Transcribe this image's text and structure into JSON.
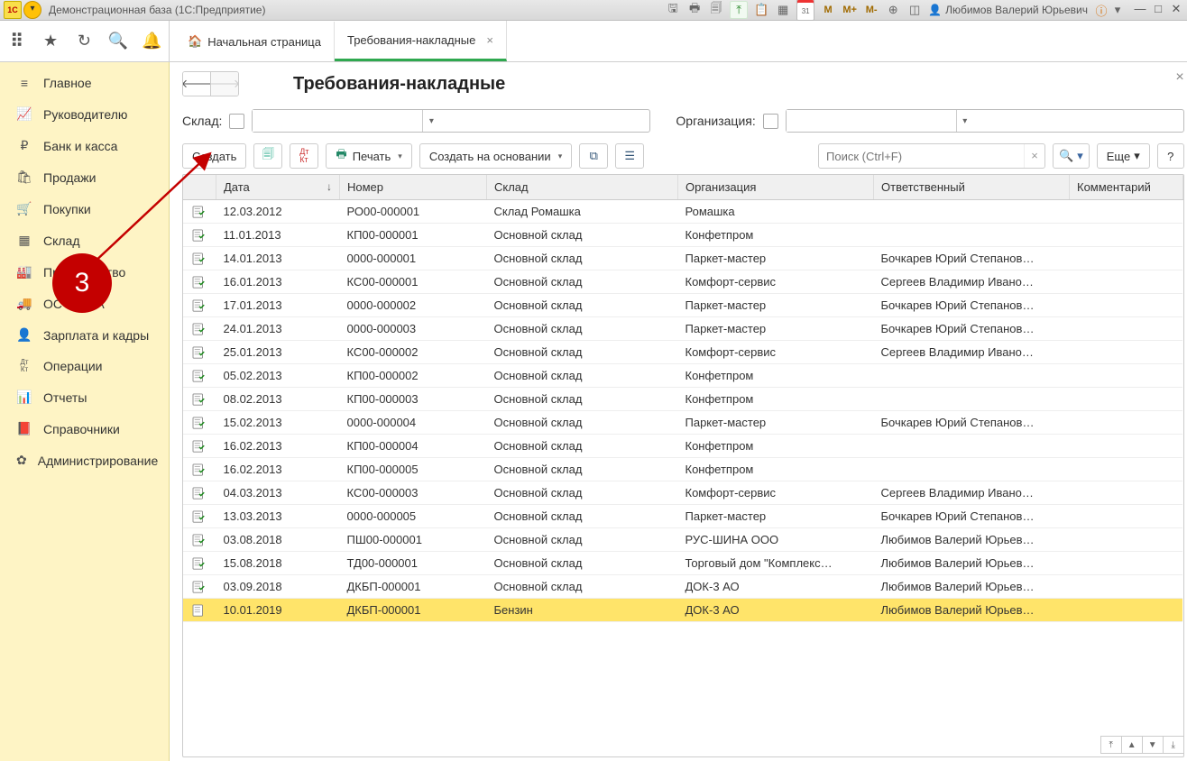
{
  "titlebar": {
    "app": "Демонстрационная база  (1С:Предприятие)",
    "user": "Любимов Валерий Юрьевич",
    "calendar_label": "31"
  },
  "tabs": {
    "home": "Начальная страница",
    "active": "Требования-накладные"
  },
  "sidebar": [
    {
      "icon": "≡",
      "label": "Главное"
    },
    {
      "icon": "📈",
      "label": "Руководителю"
    },
    {
      "icon": "₽",
      "label": "Банк и касса"
    },
    {
      "icon": "🛍",
      "label": "Продажи"
    },
    {
      "icon": "🛒",
      "label": "Покупки"
    },
    {
      "icon": "▦",
      "label": "Склад"
    },
    {
      "icon": "🏭",
      "label": "Производство"
    },
    {
      "icon": "🚚",
      "label": "ОС и НМА"
    },
    {
      "icon": "👤",
      "label": "Зарплата и кадры"
    },
    {
      "icon": "ДтКт",
      "label": "Операции"
    },
    {
      "icon": "📊",
      "label": "Отчеты"
    },
    {
      "icon": "📕",
      "label": "Справочники"
    },
    {
      "icon": "✿",
      "label": "Администрирование"
    }
  ],
  "page": {
    "title": "Требования-накладные"
  },
  "filters": {
    "warehouse_label": "Склад:",
    "org_label": "Организация:"
  },
  "toolbar": {
    "create": "Создать",
    "print": "Печать",
    "create_based": "Создать на основании",
    "search_placeholder": "Поиск (Ctrl+F)",
    "more": "Еще",
    "help": "?"
  },
  "columns": {
    "date": "Дата",
    "number": "Номер",
    "store": "Склад",
    "org": "Организация",
    "resp": "Ответственный",
    "comment": "Комментарий"
  },
  "rows": [
    {
      "date": "12.03.2012",
      "num": "РО00-000001",
      "store": "Склад Ромашка",
      "org": "Ромашка",
      "resp": "",
      "comment": ""
    },
    {
      "date": "11.01.2013",
      "num": "КП00-000001",
      "store": "Основной склад",
      "org": "Конфетпром",
      "resp": "",
      "comment": ""
    },
    {
      "date": "14.01.2013",
      "num": "0000-000001",
      "store": "Основной склад",
      "org": "Паркет-мастер",
      "resp": "Бочкарев Юрий Степанов…",
      "comment": ""
    },
    {
      "date": "16.01.2013",
      "num": "КС00-000001",
      "store": "Основной склад",
      "org": "Комфорт-сервис",
      "resp": "Сергеев Владимир Ивано…",
      "comment": ""
    },
    {
      "date": "17.01.2013",
      "num": "0000-000002",
      "store": "Основной склад",
      "org": "Паркет-мастер",
      "resp": "Бочкарев Юрий Степанов…",
      "comment": ""
    },
    {
      "date": "24.01.2013",
      "num": "0000-000003",
      "store": "Основной склад",
      "org": "Паркет-мастер",
      "resp": "Бочкарев Юрий Степанов…",
      "comment": ""
    },
    {
      "date": "25.01.2013",
      "num": "КС00-000002",
      "store": "Основной склад",
      "org": "Комфорт-сервис",
      "resp": "Сергеев Владимир Ивано…",
      "comment": ""
    },
    {
      "date": "05.02.2013",
      "num": "КП00-000002",
      "store": "Основной склад",
      "org": "Конфетпром",
      "resp": "",
      "comment": ""
    },
    {
      "date": "08.02.2013",
      "num": "КП00-000003",
      "store": "Основной склад",
      "org": "Конфетпром",
      "resp": "",
      "comment": ""
    },
    {
      "date": "15.02.2013",
      "num": "0000-000004",
      "store": "Основной склад",
      "org": "Паркет-мастер",
      "resp": "Бочкарев Юрий Степанов…",
      "comment": ""
    },
    {
      "date": "16.02.2013",
      "num": "КП00-000004",
      "store": "Основной склад",
      "org": "Конфетпром",
      "resp": "",
      "comment": ""
    },
    {
      "date": "16.02.2013",
      "num": "КП00-000005",
      "store": "Основной склад",
      "org": "Конфетпром",
      "resp": "",
      "comment": ""
    },
    {
      "date": "04.03.2013",
      "num": "КС00-000003",
      "store": "Основной склад",
      "org": "Комфорт-сервис",
      "resp": "Сергеев Владимир Ивано…",
      "comment": ""
    },
    {
      "date": "13.03.2013",
      "num": "0000-000005",
      "store": "Основной склад",
      "org": "Паркет-мастер",
      "resp": "Бочкарев Юрий Степанов…",
      "comment": ""
    },
    {
      "date": "03.08.2018",
      "num": "ПШ00-000001",
      "store": "Основной склад",
      "org": "РУС-ШИНА ООО",
      "resp": "Любимов Валерий Юрьев…",
      "comment": ""
    },
    {
      "date": "15.08.2018",
      "num": "ТД00-000001",
      "store": "Основной склад",
      "org": "Торговый дом \"Комплекс…",
      "resp": "Любимов Валерий Юрьев…",
      "comment": ""
    },
    {
      "date": "03.09.2018",
      "num": "ДКБП-000001",
      "store": "Основной склад",
      "org": "ДОК-3 АО",
      "resp": "Любимов Валерий Юрьев…",
      "comment": ""
    },
    {
      "date": "10.01.2019",
      "num": "ДКБП-000001",
      "store": "Бензин",
      "org": "ДОК-3 АО",
      "resp": "Любимов Валерий Юрьев…",
      "comment": "",
      "selected": true,
      "draft": true
    }
  ],
  "annotation": {
    "number": "3"
  }
}
